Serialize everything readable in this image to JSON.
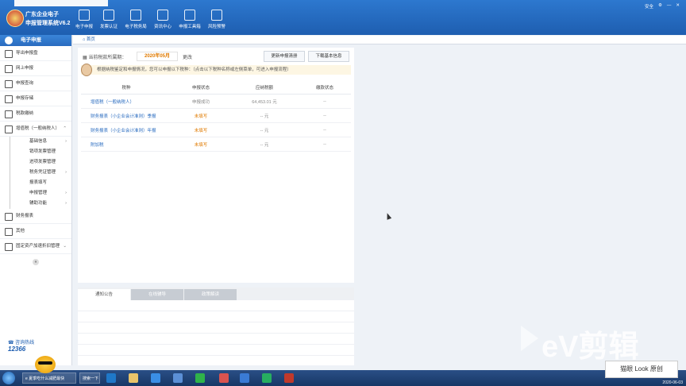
{
  "app": {
    "title_line1": "广东企业电子",
    "title_line2": "申报管理系统V6.2"
  },
  "nav": [
    {
      "label": "电子申报",
      "icon": "calendar-icon"
    },
    {
      "label": "发票认证",
      "icon": "invoice-icon"
    },
    {
      "label": "电子税务局",
      "icon": "grid-icon"
    },
    {
      "label": "资讯中心",
      "icon": "chat-icon"
    },
    {
      "label": "申报工具箱",
      "icon": "building-icon"
    },
    {
      "label": "风险预警",
      "icon": "document-icon"
    }
  ],
  "topright": {
    "security": "安全",
    "icons": [
      "gear-icon",
      "minimize-icon",
      "close-icon"
    ]
  },
  "sidebar": {
    "header": "电子申报",
    "items": [
      {
        "label": "导出申报盘"
      },
      {
        "label": "网上申报"
      },
      {
        "label": "申报查询"
      },
      {
        "label": "申报存储"
      },
      {
        "label": "税款缴纳"
      },
      {
        "label": "增值税（一般纳税人）"
      }
    ],
    "subitems": [
      {
        "label": "基础信息",
        "arrow": true
      },
      {
        "label": "销项发票管理",
        "arrow": false
      },
      {
        "label": "进项发票管理",
        "arrow": false
      },
      {
        "label": "税务凭证管理",
        "arrow": true
      },
      {
        "label": "报表填写",
        "arrow": false
      },
      {
        "label": "申报管理",
        "arrow": true
      },
      {
        "label": "辅助功能",
        "arrow": true
      }
    ],
    "bottom_items": [
      {
        "label": "财务报表"
      },
      {
        "label": "其他"
      },
      {
        "label": "固定资产加速折旧管理"
      }
    ],
    "hotline_label": "咨询热线",
    "hotline_number": "12366"
  },
  "breadcrumb": "首页",
  "period": {
    "label": "当前税款所属期：",
    "value": "2020年05月",
    "change": "更改"
  },
  "buttons": {
    "update_list": "更新申报清册",
    "download_info": "下载基本信息"
  },
  "tip": "根据纳税鉴定和申报情况，您可以申报以下税种：（点击以下税种名称或左侧菜单，可进入申报流程）",
  "table": {
    "headers": [
      "税种",
      "申报状态",
      "应纳税额",
      "缴款状态"
    ],
    "rows": [
      {
        "tax": "增值税（一般纳税人）",
        "status": "申报成功",
        "amount": "64,453.01 元",
        "pay": "--",
        "status_type": "ok"
      },
      {
        "tax": "财务报表（小企业会计准则）季报",
        "status": "未填写",
        "amount": "-- 元",
        "pay": "--",
        "status_type": "no"
      },
      {
        "tax": "财务报表（小企业会计准则）年报",
        "status": "未填写",
        "amount": "-- 元",
        "pay": "--",
        "status_type": "no"
      },
      {
        "tax": "附加税",
        "status": "未填写",
        "amount": "-- 元",
        "pay": "--",
        "status_type": "no"
      }
    ]
  },
  "tabs": [
    {
      "label": "通知公告",
      "active": true
    },
    {
      "label": "在线辅导",
      "active": false
    },
    {
      "label": "政策解读",
      "active": false
    }
  ],
  "taskbar": {
    "app1": "夏季吃什么减肥最快",
    "app2": "搜索一下"
  },
  "watermark": "eV剪辑",
  "sticker": "猫眼 Look  原创",
  "datetime": "2020-06-03"
}
